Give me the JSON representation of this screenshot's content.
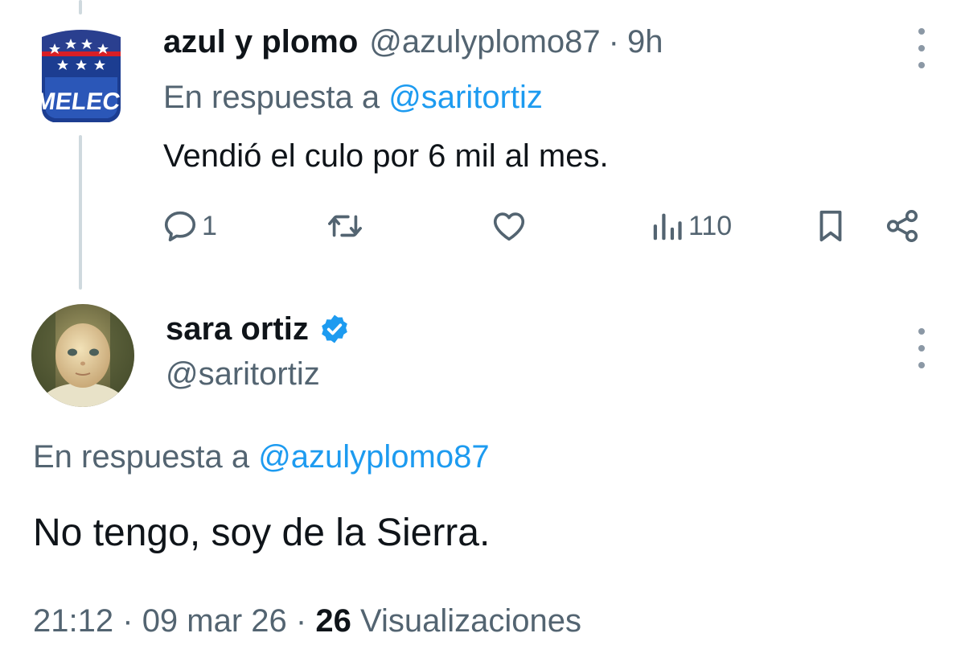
{
  "reply_tweet": {
    "author_name": "azul y plomo",
    "handle": "@azulyplomo87",
    "separator": "·",
    "time": "9h",
    "in_reply_prefix": "En respuesta a",
    "in_reply_to": "@saritortiz",
    "text": "Vendió el culo por 6 mil al mes.",
    "avatar_text": "EMELEC",
    "actions": {
      "reply_count": "1",
      "retweet_count": "",
      "like_count": "",
      "views_count": "110"
    },
    "icons": [
      "reply-icon",
      "retweet-icon",
      "heart-icon",
      "views-icon",
      "bookmark-icon",
      "share-icon",
      "more-icon"
    ]
  },
  "main_tweet": {
    "author_name": "sara ortiz",
    "handle": "@saritortiz",
    "in_reply_prefix": "En respuesta a",
    "in_reply_to": "@azulyplomo87",
    "text": "No tengo, soy de la Sierra.",
    "time": "21:12",
    "date": "09 mar 26",
    "separator": "·",
    "views_count": "26",
    "views_label": "Visualizaciones"
  },
  "colors": {
    "text": "#0f1419",
    "secondary": "#536471",
    "accent": "#1d9bf0",
    "thread_line": "#cfd9de"
  }
}
